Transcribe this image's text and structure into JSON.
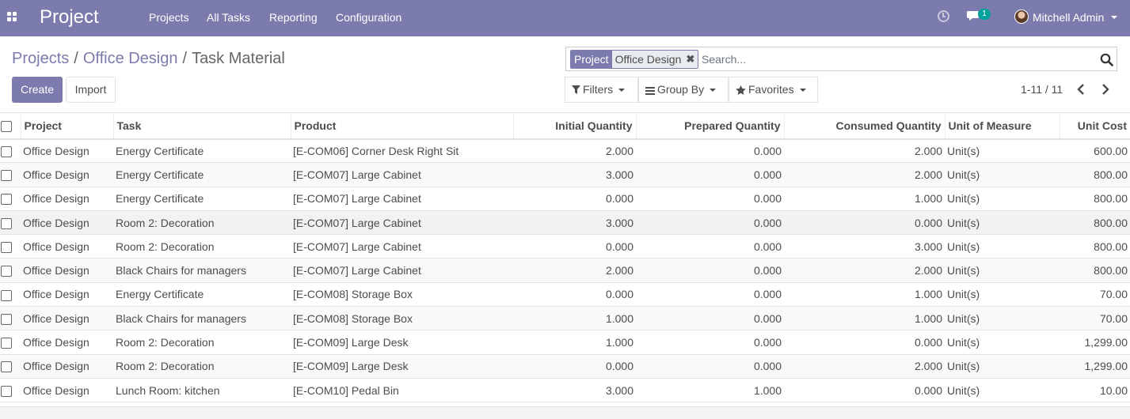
{
  "navbar": {
    "app_title": "Project",
    "menu": [
      "Projects",
      "All Tasks",
      "Reporting",
      "Configuration"
    ],
    "chat_count": "1",
    "user_name": "Mitchell Admin",
    "color": "#7c7bad"
  },
  "breadcrumb": {
    "items": [
      "Projects",
      "Office Design"
    ],
    "current": "Task Material",
    "separator": "/"
  },
  "buttons": {
    "create": "Create",
    "import": "Import"
  },
  "search": {
    "facet_label": "Project",
    "facet_value": "Office Design",
    "placeholder": "Search..."
  },
  "filters": {
    "filters": "Filters",
    "group_by": "Group By",
    "favorites": "Favorites"
  },
  "pager": {
    "value": "1-11 / 11"
  },
  "table": {
    "columns": [
      "Project",
      "Task",
      "Product",
      "Initial Quantity",
      "Prepared Quantity",
      "Consumed Quantity",
      "Unit of Measure",
      "Unit Cost"
    ],
    "rows": [
      [
        "Office Design",
        "Energy Certificate",
        "[E-COM06] Corner Desk Right Sit",
        "2.000",
        "0.000",
        "2.000",
        "Unit(s)",
        "600.00"
      ],
      [
        "Office Design",
        "Energy Certificate",
        "[E-COM07] Large Cabinet",
        "3.000",
        "0.000",
        "2.000",
        "Unit(s)",
        "800.00"
      ],
      [
        "Office Design",
        "Energy Certificate",
        "[E-COM07] Large Cabinet",
        "0.000",
        "0.000",
        "1.000",
        "Unit(s)",
        "800.00"
      ],
      [
        "Office Design",
        "Room 2: Decoration",
        "[E-COM07] Large Cabinet",
        "3.000",
        "0.000",
        "0.000",
        "Unit(s)",
        "800.00"
      ],
      [
        "Office Design",
        "Room 2: Decoration",
        "[E-COM07] Large Cabinet",
        "0.000",
        "0.000",
        "3.000",
        "Unit(s)",
        "800.00"
      ],
      [
        "Office Design",
        "Black Chairs for managers",
        "[E-COM07] Large Cabinet",
        "2.000",
        "0.000",
        "2.000",
        "Unit(s)",
        "800.00"
      ],
      [
        "Office Design",
        "Energy Certificate",
        "[E-COM08] Storage Box",
        "0.000",
        "0.000",
        "1.000",
        "Unit(s)",
        "70.00"
      ],
      [
        "Office Design",
        "Black Chairs for managers",
        "[E-COM08] Storage Box",
        "1.000",
        "0.000",
        "1.000",
        "Unit(s)",
        "70.00"
      ],
      [
        "Office Design",
        "Room 2: Decoration",
        "[E-COM09] Large Desk",
        "1.000",
        "0.000",
        "0.000",
        "Unit(s)",
        "1,299.00"
      ],
      [
        "Office Design",
        "Room 2: Decoration",
        "[E-COM09] Large Desk",
        "0.000",
        "0.000",
        "2.000",
        "Unit(s)",
        "1,299.00"
      ],
      [
        "Office Design",
        "Lunch Room: kitchen",
        "[E-COM10] Pedal Bin",
        "3.000",
        "1.000",
        "0.000",
        "Unit(s)",
        "10.00"
      ]
    ]
  }
}
